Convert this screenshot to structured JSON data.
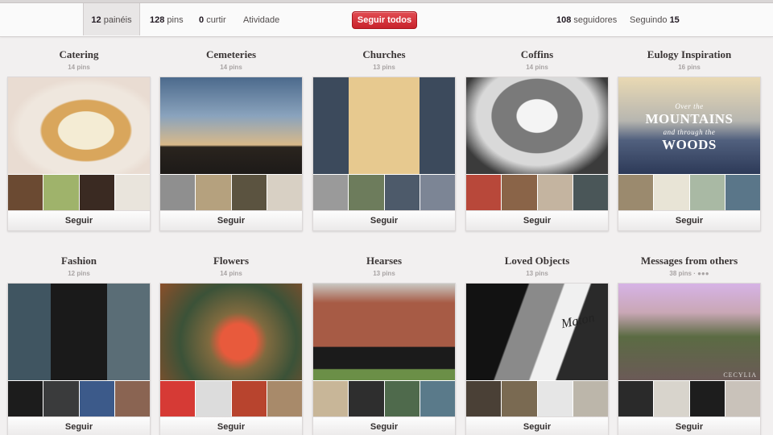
{
  "stats": {
    "boards": {
      "count": "12",
      "label": "painéis"
    },
    "pins": {
      "count": "128",
      "label": "pins"
    },
    "likes": {
      "count": "0",
      "label": "curtir"
    },
    "activity": "Atividade",
    "follow_all": "Seguir todos",
    "followers": {
      "count": "108",
      "label": "seguidores"
    },
    "following": {
      "label": "Seguindo",
      "count": "15"
    }
  },
  "colors": {
    "accent": "#cb2027",
    "background": "#f2f0f0"
  },
  "boards": [
    {
      "title": "Catering",
      "count": "14 pins",
      "follow": "Seguir"
    },
    {
      "title": "Cemeteries",
      "count": "14 pins",
      "follow": "Seguir"
    },
    {
      "title": "Churches",
      "count": "13 pins",
      "follow": "Seguir"
    },
    {
      "title": "Coffins",
      "count": "14 pins",
      "follow": "Seguir"
    },
    {
      "title": "Eulogy Inspiration",
      "count": "16 pins",
      "follow": "Seguir",
      "cover_text": {
        "line1": "Over the",
        "line2": "Mountains",
        "line3": "and through the",
        "line4": "Woods"
      }
    },
    {
      "title": "Fashion",
      "count": "12 pins",
      "follow": "Seguir"
    },
    {
      "title": "Flowers",
      "count": "14 pins",
      "follow": "Seguir"
    },
    {
      "title": "Hearses",
      "count": "13 pins",
      "follow": "Seguir"
    },
    {
      "title": "Loved Objects",
      "count": "13 pins",
      "follow": "Seguir",
      "cover_text": {
        "brand": "Maton"
      }
    },
    {
      "title": "Messages from others",
      "count": "38 pins ·",
      "group_icon": "group-board-icon",
      "follow": "Seguir",
      "watermark": "CECYLIA"
    }
  ]
}
